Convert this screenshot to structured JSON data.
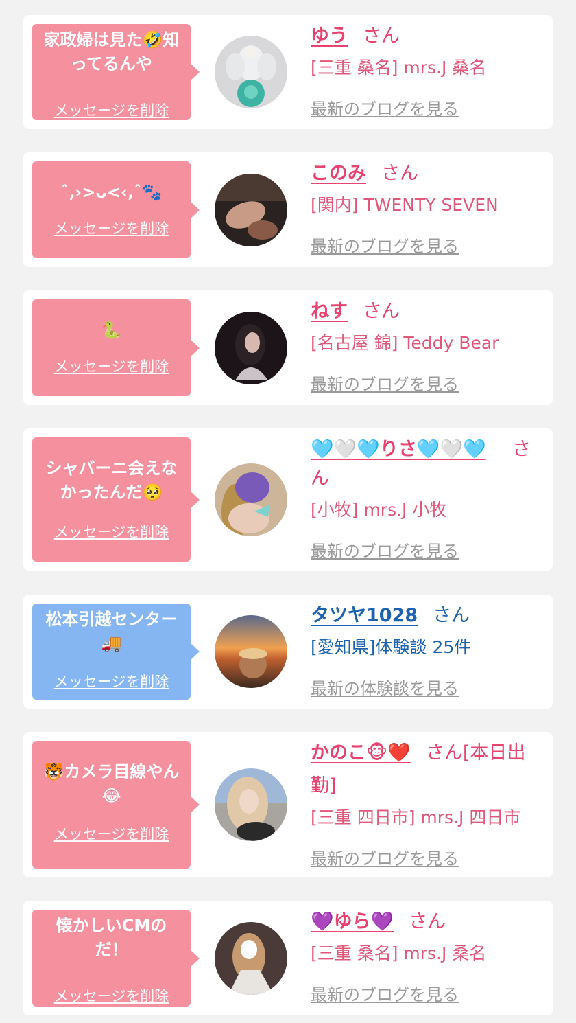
{
  "delete_label": "メッセージを削除",
  "suffix": "さん",
  "cards": [
    {
      "message": "家政婦は見た🤣知ってるんや",
      "name": "ゆう",
      "shop": "[三重 桑名] mrs.J 桑名",
      "blog_link": "最新のブログを見る",
      "avatar": "angel-figurine-photo"
    },
    {
      "message": "ˆ‚›>ᴗ<‹‚ˆ🐾",
      "name": "このみ",
      "shop": "[関内] TWENTY SEVEN",
      "blog_link": "最新のブログを見る",
      "avatar": "hand-photo"
    },
    {
      "message": "🐍",
      "name": "ねす",
      "shop": "[名古屋 錦] Teddy Bear",
      "blog_link": "最新のブログを見る",
      "avatar": "profile-photo"
    },
    {
      "message": "シャバーニ会えなかったんだ🥺",
      "name": "🩵🤍🩵りさ🩵🤍🩵",
      "name_trail": "さ",
      "shop_first": "ん",
      "shop": "[小牧] mrs.J 小牧",
      "blog_link": "最新のブログを見る",
      "avatar": "profile-photo"
    },
    {
      "message": "松本引越センター🚚",
      "name": "タツヤ1028",
      "shop": "[愛知県]体験談 25件",
      "blog_link": "最新の体験談を見る",
      "avatar": "sunset-profile-photo"
    },
    {
      "message": "🐯カメラ目線やん😂",
      "name": "かのこ🐵❤️",
      "name_trail": "さん[本日出",
      "shop_first": "勤]",
      "shop": "[三重 四日市] mrs.J 四日市",
      "blog_link": "最新のブログを見る",
      "avatar": "profile-photo"
    },
    {
      "message": "懐かしいCMのだ！",
      "name": "💜ゆら💜",
      "shop": "[三重 桑名] mrs.J 桑名",
      "blog_link": "最新のブログを見る",
      "avatar": "kimono-photo"
    }
  ],
  "colors": {
    "background": "#f2f2f2",
    "bubble_pink": "#f5909f",
    "bubble_blue": "#86b6f2",
    "name_pink": "#e8426f",
    "name_blue": "#1b63b0",
    "link_gray": "#9a9a9a"
  }
}
